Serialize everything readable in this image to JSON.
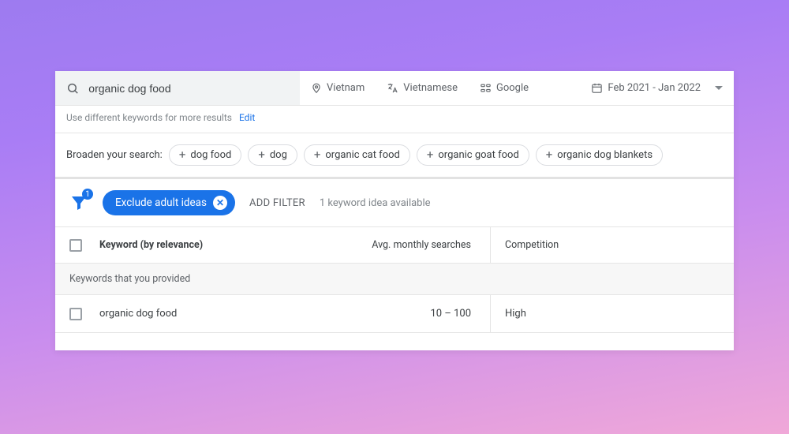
{
  "search": {
    "query": "organic dog food"
  },
  "selectors": {
    "location": "Vietnam",
    "language": "Vietnamese",
    "network": "Google",
    "date_range": "Feb 2021 - Jan 2022"
  },
  "hint": {
    "text": "Use different keywords for more results",
    "edit": "Edit"
  },
  "broaden": {
    "label": "Broaden your search:",
    "chips": [
      "dog food",
      "dog",
      "organic cat food",
      "organic goat food",
      "organic dog blankets"
    ]
  },
  "filters": {
    "badge": "1",
    "active_chip": "Exclude adult ideas",
    "add_filter": "ADD FILTER",
    "available": "1 keyword idea available"
  },
  "table": {
    "headers": {
      "keyword": "Keyword (by relevance)",
      "avg": "Avg. monthly searches",
      "comp": "Competition"
    },
    "section_label": "Keywords that you provided",
    "rows": [
      {
        "keyword": "organic dog food",
        "avg": "10 – 100",
        "comp": "High"
      }
    ]
  }
}
